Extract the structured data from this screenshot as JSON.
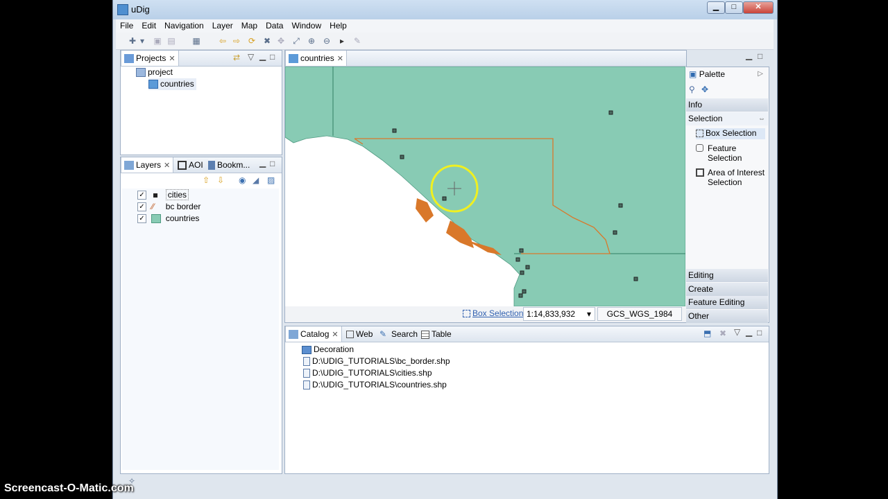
{
  "app": {
    "title": "uDig"
  },
  "menu": [
    "File",
    "Edit",
    "Navigation",
    "Layer",
    "Map",
    "Data",
    "Window",
    "Help"
  ],
  "projects_panel": {
    "tab": "Projects",
    "items": [
      {
        "label": "project"
      },
      {
        "label": "countries"
      }
    ]
  },
  "layers_panel": {
    "tabs": [
      "Layers",
      "AOI",
      "Bookm..."
    ],
    "layers": [
      {
        "label": "cities",
        "checked": true
      },
      {
        "label": "bc border",
        "checked": true
      },
      {
        "label": "countries",
        "checked": true
      }
    ]
  },
  "map_editor": {
    "tab": "countries",
    "status": {
      "tool": "Box Selection",
      "scale": "1:14,833,932",
      "crs": "GCS_WGS_1984"
    },
    "colors": {
      "water": "#ffffff",
      "land": "#88cbb4",
      "border": "#d9782a",
      "cities": "#333333"
    }
  },
  "palette": {
    "title": "Palette",
    "categories": [
      "Info",
      "Selection",
      "Editing",
      "Create",
      "Feature Editing",
      "Other"
    ],
    "selection_tools": [
      "Box Selection",
      "Feature\nSelection",
      "Area of Interest\nSelection"
    ]
  },
  "bottom_panel": {
    "tabs": [
      "Catalog",
      "Web",
      "Search",
      "Table"
    ],
    "items": [
      {
        "label": "Decoration",
        "icon": "folder-icon"
      },
      {
        "label": "D:\\UDIG_TUTORIALS\\bc_border.shp",
        "icon": "file-icon"
      },
      {
        "label": "D:\\UDIG_TUTORIALS\\cities.shp",
        "icon": "file-icon"
      },
      {
        "label": "D:\\UDIG_TUTORIALS\\countries.shp",
        "icon": "file-icon"
      }
    ]
  },
  "watermark": "Screencast-O-Matic.com"
}
